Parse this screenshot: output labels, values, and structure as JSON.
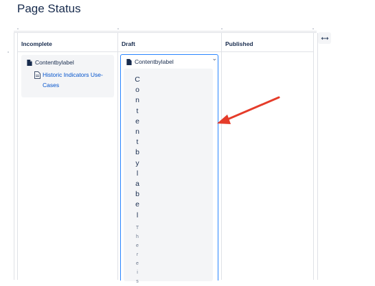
{
  "page": {
    "title": "Page Status"
  },
  "columns": [
    {
      "header": "Incomplete"
    },
    {
      "header": "Draft"
    },
    {
      "header": "Published"
    }
  ],
  "incomplete_card": {
    "title": "Contentbylabel",
    "link": "Historic Indicators Use-Cases"
  },
  "draft_card": {
    "title": "Contentbylabel",
    "vertical_title_chars": [
      "C",
      "o",
      "n",
      "t",
      "e",
      "n",
      "t",
      "b",
      "y",
      "l",
      "a",
      "b",
      "e",
      "l"
    ],
    "vertical_body_chars": [
      "T",
      "h",
      "e",
      "r",
      "e",
      "i",
      "s"
    ]
  },
  "icons": {
    "doc": "document-icon",
    "page": "page-icon",
    "chevron": "chevron-down-icon",
    "resize": "expand-horizontal-icon",
    "annotation": "red-arrow"
  },
  "colors": {
    "accent": "#2684ff",
    "link": "#0052cc",
    "arrow": "#e53c2a"
  }
}
